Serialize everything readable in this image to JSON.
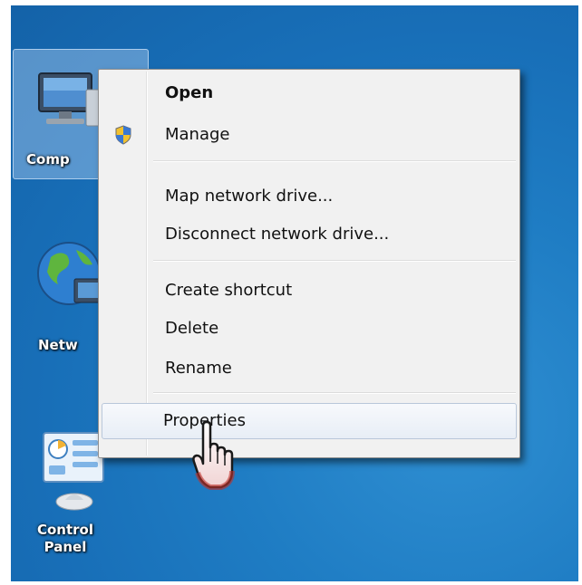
{
  "desktop": {
    "icons": [
      {
        "name": "computer-icon",
        "label": "Comp"
      },
      {
        "name": "network-icon",
        "label": "Netw"
      },
      {
        "name": "control-panel-icon",
        "label_line1": "Control",
        "label_line2": "Panel"
      }
    ]
  },
  "context_menu": {
    "items": [
      {
        "label": "Open",
        "bold": true
      },
      {
        "label": "Manage",
        "icon": "uac-shield-icon"
      },
      {
        "label": "Map network drive..."
      },
      {
        "label": "Disconnect network drive..."
      },
      {
        "label": "Create shortcut"
      },
      {
        "label": "Delete"
      },
      {
        "label": "Rename"
      },
      {
        "label": "Properties",
        "hovered": true
      }
    ]
  },
  "cursor": {
    "type": "hand-pointer-icon"
  },
  "colors": {
    "desktop_bg": "#1a72ba",
    "menu_bg": "#f1f1f1",
    "menu_hover": "#e8eef6"
  }
}
